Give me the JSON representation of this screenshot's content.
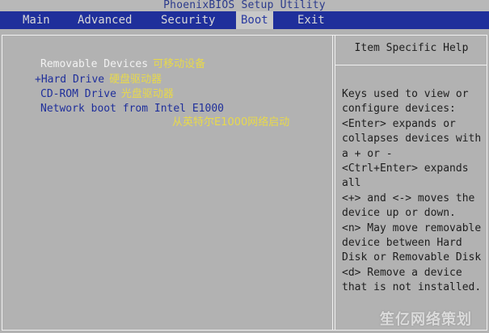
{
  "title_bar": {
    "title": "PhoenixBIOS Setup Utility"
  },
  "menu": [
    {
      "label": "Main",
      "active": false
    },
    {
      "label": "Advanced",
      "active": false
    },
    {
      "label": "Security",
      "active": false
    },
    {
      "label": "Boot",
      "active": true
    },
    {
      "label": "Exit",
      "active": false
    }
  ],
  "boot_order": [
    {
      "label": "Removable Devices",
      "annotation": "可移动设备",
      "selected": true
    },
    {
      "label": "+Hard Drive",
      "annotation": "硬盘驱动器",
      "selected": false
    },
    {
      "label": "CD-ROM Drive",
      "annotation": "光盘驱动器",
      "selected": false
    },
    {
      "label": "Network boot from Intel E1000",
      "annotation": "",
      "selected": false
    }
  ],
  "network_annotation": "从英特尔E1000网络启动",
  "help_panel": {
    "title": "Item Specific Help",
    "lines": [
      "Keys used to view or",
      "configure devices:",
      "<Enter> expands or",
      "collapses devices with",
      "a + or -",
      "<Ctrl+Enter> expands",
      "all",
      "<+> and <-> moves the",
      "device up or down.",
      "<n> May move removable",
      "device between Hard",
      "Disk or Removable Disk",
      "<d> Remove a device",
      "that is not installed."
    ]
  },
  "watermark": "笙亿网络策划",
  "colors": {
    "menu_bar": "#1f2f9b",
    "background": "#b2b2b2",
    "annotation": "#e8d94a",
    "item_text": "#1f2f9b",
    "selected_text": "#f2f2f2"
  }
}
